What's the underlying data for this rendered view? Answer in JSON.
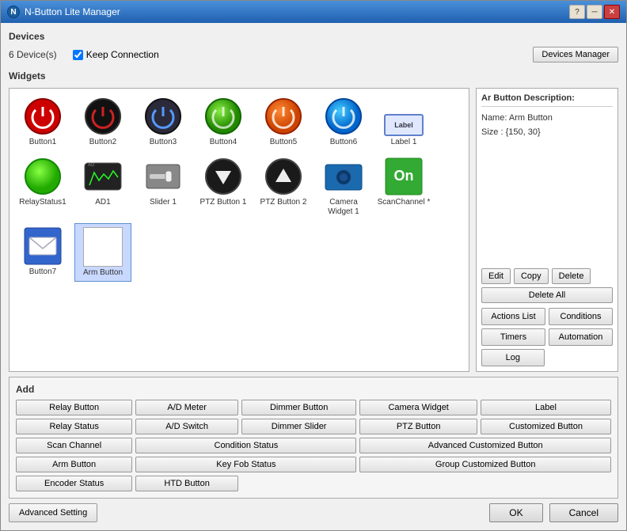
{
  "window": {
    "title": "N-Button Lite Manager",
    "icon_label": "N"
  },
  "devices": {
    "label": "Devices",
    "count": "6 Device(s)",
    "keep_connection_label": "Keep Connection",
    "keep_connection_checked": true,
    "devices_manager_btn": "Devices Manager"
  },
  "widgets": {
    "label": "Widgets",
    "items": [
      {
        "name": "Button1",
        "type": "power-red"
      },
      {
        "name": "Button2",
        "type": "power-black-red"
      },
      {
        "name": "Button3",
        "type": "power-dark"
      },
      {
        "name": "Button4",
        "type": "power-green"
      },
      {
        "name": "Button5",
        "type": "power-orange"
      },
      {
        "name": "Button6",
        "type": "power-cyan"
      },
      {
        "name": "Label 1",
        "type": "label-widget"
      },
      {
        "name": "RelayStatus1",
        "type": "relay-green"
      },
      {
        "name": "AD1",
        "type": "ad1"
      },
      {
        "name": "Slider 1",
        "type": "slider"
      },
      {
        "name": "PTZ Button 1",
        "type": "ptz-down"
      },
      {
        "name": "PTZ Button 2",
        "type": "ptz-up"
      },
      {
        "name": "Camera Widget 1",
        "type": "camera"
      },
      {
        "name": "ScanChannel *",
        "type": "scan-channel"
      },
      {
        "name": "Button7",
        "type": "email"
      },
      {
        "name": "Arm Button",
        "type": "arm"
      }
    ]
  },
  "description": {
    "title": "Ar Button Description:",
    "name_label": "Name:",
    "name_value": "Arm Button",
    "size_label": "Size :",
    "size_value": "{150, 30}"
  },
  "add": {
    "label": "Add",
    "buttons": [
      "Relay Button",
      "A/D Meter",
      "Dimmer Button",
      "Camera Widget",
      "Label",
      "Relay Status",
      "A/D Switch",
      "Dimmer Slider",
      "PTZ Button",
      "Customized Button",
      "Scan Channel",
      "Condition Status",
      "Advanced Customized Button",
      "Arm Button",
      "Key Fob Status",
      "Group Customized Button",
      "Encoder Status",
      "HTD Button"
    ]
  },
  "edit_buttons": {
    "edit": "Edit",
    "copy": "Copy",
    "delete": "Delete",
    "delete_all": "Delete All"
  },
  "action_buttons": {
    "actions_list": "Actions List",
    "conditions": "Conditions",
    "timers": "Timers",
    "automation": "Automation",
    "log": "Log"
  },
  "footer": {
    "advanced_setting": "Advanced Setting",
    "ok": "OK",
    "cancel": "Cancel"
  }
}
